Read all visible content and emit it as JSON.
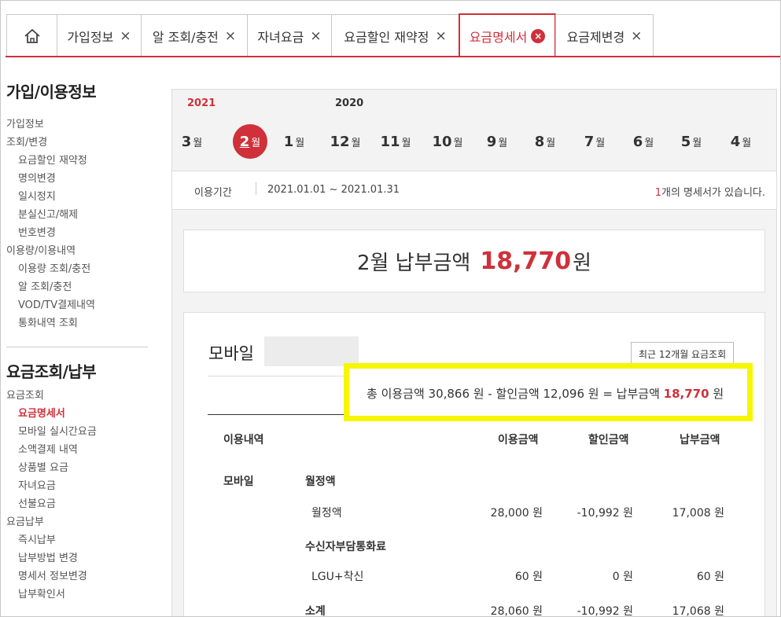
{
  "tabs": [
    {
      "label": "가입정보"
    },
    {
      "label": "알 조회/충전"
    },
    {
      "label": "자녀요금"
    },
    {
      "label": "요금할인 재약정"
    },
    {
      "label": "요금명세서",
      "active": true
    },
    {
      "label": "요금제변경"
    }
  ],
  "tab_close_glyph": "×",
  "sidebar": {
    "section1_title": "가입/이용정보",
    "section1_items": [
      {
        "label": "가입정보",
        "level": 0
      },
      {
        "label": "조회/변경",
        "level": 0
      },
      {
        "label": "요금할인 재약정",
        "level": 1
      },
      {
        "label": "명의변경",
        "level": 1
      },
      {
        "label": "일시정지",
        "level": 1
      },
      {
        "label": "분실신고/해제",
        "level": 1
      },
      {
        "label": "번호변경",
        "level": 1
      },
      {
        "label": "이용량/이용내역",
        "level": 0
      },
      {
        "label": "이용량 조회/충전",
        "level": 1
      },
      {
        "label": "알 조회/충전",
        "level": 1
      },
      {
        "label": "VOD/TV결제내역",
        "level": 1
      },
      {
        "label": "통화내역 조회",
        "level": 1
      }
    ],
    "section2_title": "요금조회/납부",
    "section2_items": [
      {
        "label": "요금조회",
        "level": 0
      },
      {
        "label": "요금명세서",
        "level": 1,
        "active": true
      },
      {
        "label": "모바일 실시간요금",
        "level": 1
      },
      {
        "label": "소액결제 내역",
        "level": 1
      },
      {
        "label": "상품별 요금",
        "level": 1
      },
      {
        "label": "자녀요금",
        "level": 1
      },
      {
        "label": "선불요금",
        "level": 1
      },
      {
        "label": "요금납부",
        "level": 0
      },
      {
        "label": "즉시납부",
        "level": 1
      },
      {
        "label": "납부방법 변경",
        "level": 1
      },
      {
        "label": "명세서 정보변경",
        "level": 1
      },
      {
        "label": "납부확인서",
        "level": 1
      }
    ]
  },
  "years": {
    "current": "2021",
    "previous": "2020"
  },
  "months": [
    {
      "num": "3",
      "unit": "월"
    },
    {
      "num": "2",
      "unit": "월",
      "active": true
    },
    {
      "num": "1",
      "unit": "월"
    },
    {
      "num": "12",
      "unit": "월"
    },
    {
      "num": "11",
      "unit": "월"
    },
    {
      "num": "10",
      "unit": "월"
    },
    {
      "num": "9",
      "unit": "월"
    },
    {
      "num": "8",
      "unit": "월"
    },
    {
      "num": "7",
      "unit": "월"
    },
    {
      "num": "6",
      "unit": "월"
    },
    {
      "num": "5",
      "unit": "월"
    },
    {
      "num": "4",
      "unit": "월"
    }
  ],
  "period": {
    "label": "이용기간",
    "range": "2021.01.01 ~ 2021.01.31",
    "count": "1",
    "count_suffix": "개의 명세서가 있습니다."
  },
  "payment": {
    "prefix": "2월 납부금액",
    "amount": "18,770",
    "unit": "원"
  },
  "detail": {
    "service": "모바일",
    "recent_button": "최근 12개월 요금조회",
    "summary_text": "총 이용금액 30,866 원 - 할인금액 12,096 원 = 납부금액",
    "summary_amount": "18,770",
    "summary_unit": "원",
    "headers": {
      "item": "이용내역",
      "usage": "이용금액",
      "discount": "할인금액",
      "pay": "납부금액"
    },
    "category": "모바일",
    "rows": [
      {
        "label": "월정액",
        "type": "group"
      },
      {
        "label": "월정액",
        "type": "item",
        "usage": "28,000 원",
        "discount": "-10,992 원",
        "pay": "17,008 원"
      },
      {
        "label": "수신자부담통화료",
        "type": "group"
      },
      {
        "label": "LGU+착신",
        "type": "item",
        "usage": "60 원",
        "discount": "0 원",
        "pay": "60 원"
      },
      {
        "label": "소계",
        "type": "subtotal",
        "usage": "28,060 원",
        "discount": "-10,992 원",
        "pay": "17,068 원"
      }
    ]
  },
  "colors": {
    "accent": "#d0303a",
    "highlight": "#f6f600"
  }
}
